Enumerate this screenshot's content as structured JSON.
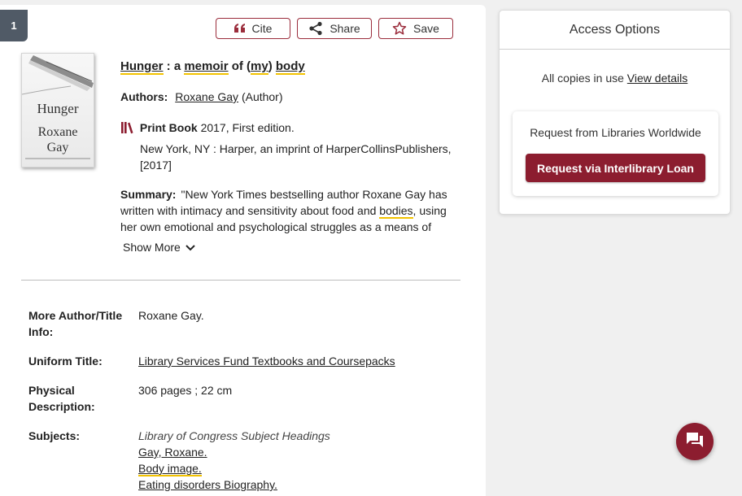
{
  "result": {
    "number": "1"
  },
  "actions": {
    "cite": "Cite",
    "share": "Share",
    "save": "Save"
  },
  "cover": {
    "title": "Hunger",
    "author_line1": "Roxane",
    "author_line2": "Gay"
  },
  "record": {
    "title_w1": "Hunger",
    "title_sep": " : a ",
    "title_w2": "memoir",
    "title_w3": " of (",
    "title_w4": "my",
    "title_w5": ") ",
    "title_w6": "body",
    "authors_label": "Authors:",
    "author_name": "Roxane Gay",
    "author_role": "(Author)",
    "format_name": "Print Book",
    "format_info": "2017, First edition.",
    "publisher": "New York, NY : Harper, an imprint of HarperCollinsPublishers, [2017]",
    "summary_label": "Summary:",
    "summary_part1": "\"New York Times bestselling author Roxane Gay has written with intimacy and sensitivity about food and ",
    "summary_hl": "bodies",
    "summary_part2": ", using her own emotional and psychological struggles as a means of",
    "show_more": "Show More"
  },
  "details": {
    "more_author_label": "More Author/Title Info:",
    "more_author_value": "Roxane Gay.",
    "uniform_title_label": "Uniform Title:",
    "uniform_title_value": "Library Services Fund Textbooks and Coursepacks",
    "physical_label": "Physical Description:",
    "physical_value": "306 pages ; 22 cm",
    "subjects_label": "Subjects:",
    "subjects_heading": "Library of Congress Subject Headings",
    "subject_1": "Gay, Roxane.",
    "subject_2": "Body image.",
    "subject_3": "Eating disorders Biography."
  },
  "access": {
    "title": "Access Options",
    "copies_text": "All copies in use",
    "view_details": "View details",
    "request_text": "Request from Libraries Worldwide",
    "ill_button": "Request via Interlibrary Loan"
  },
  "colors": {
    "accent": "#8c1d2f",
    "highlight": "#f2c200",
    "badge": "#505a66"
  }
}
